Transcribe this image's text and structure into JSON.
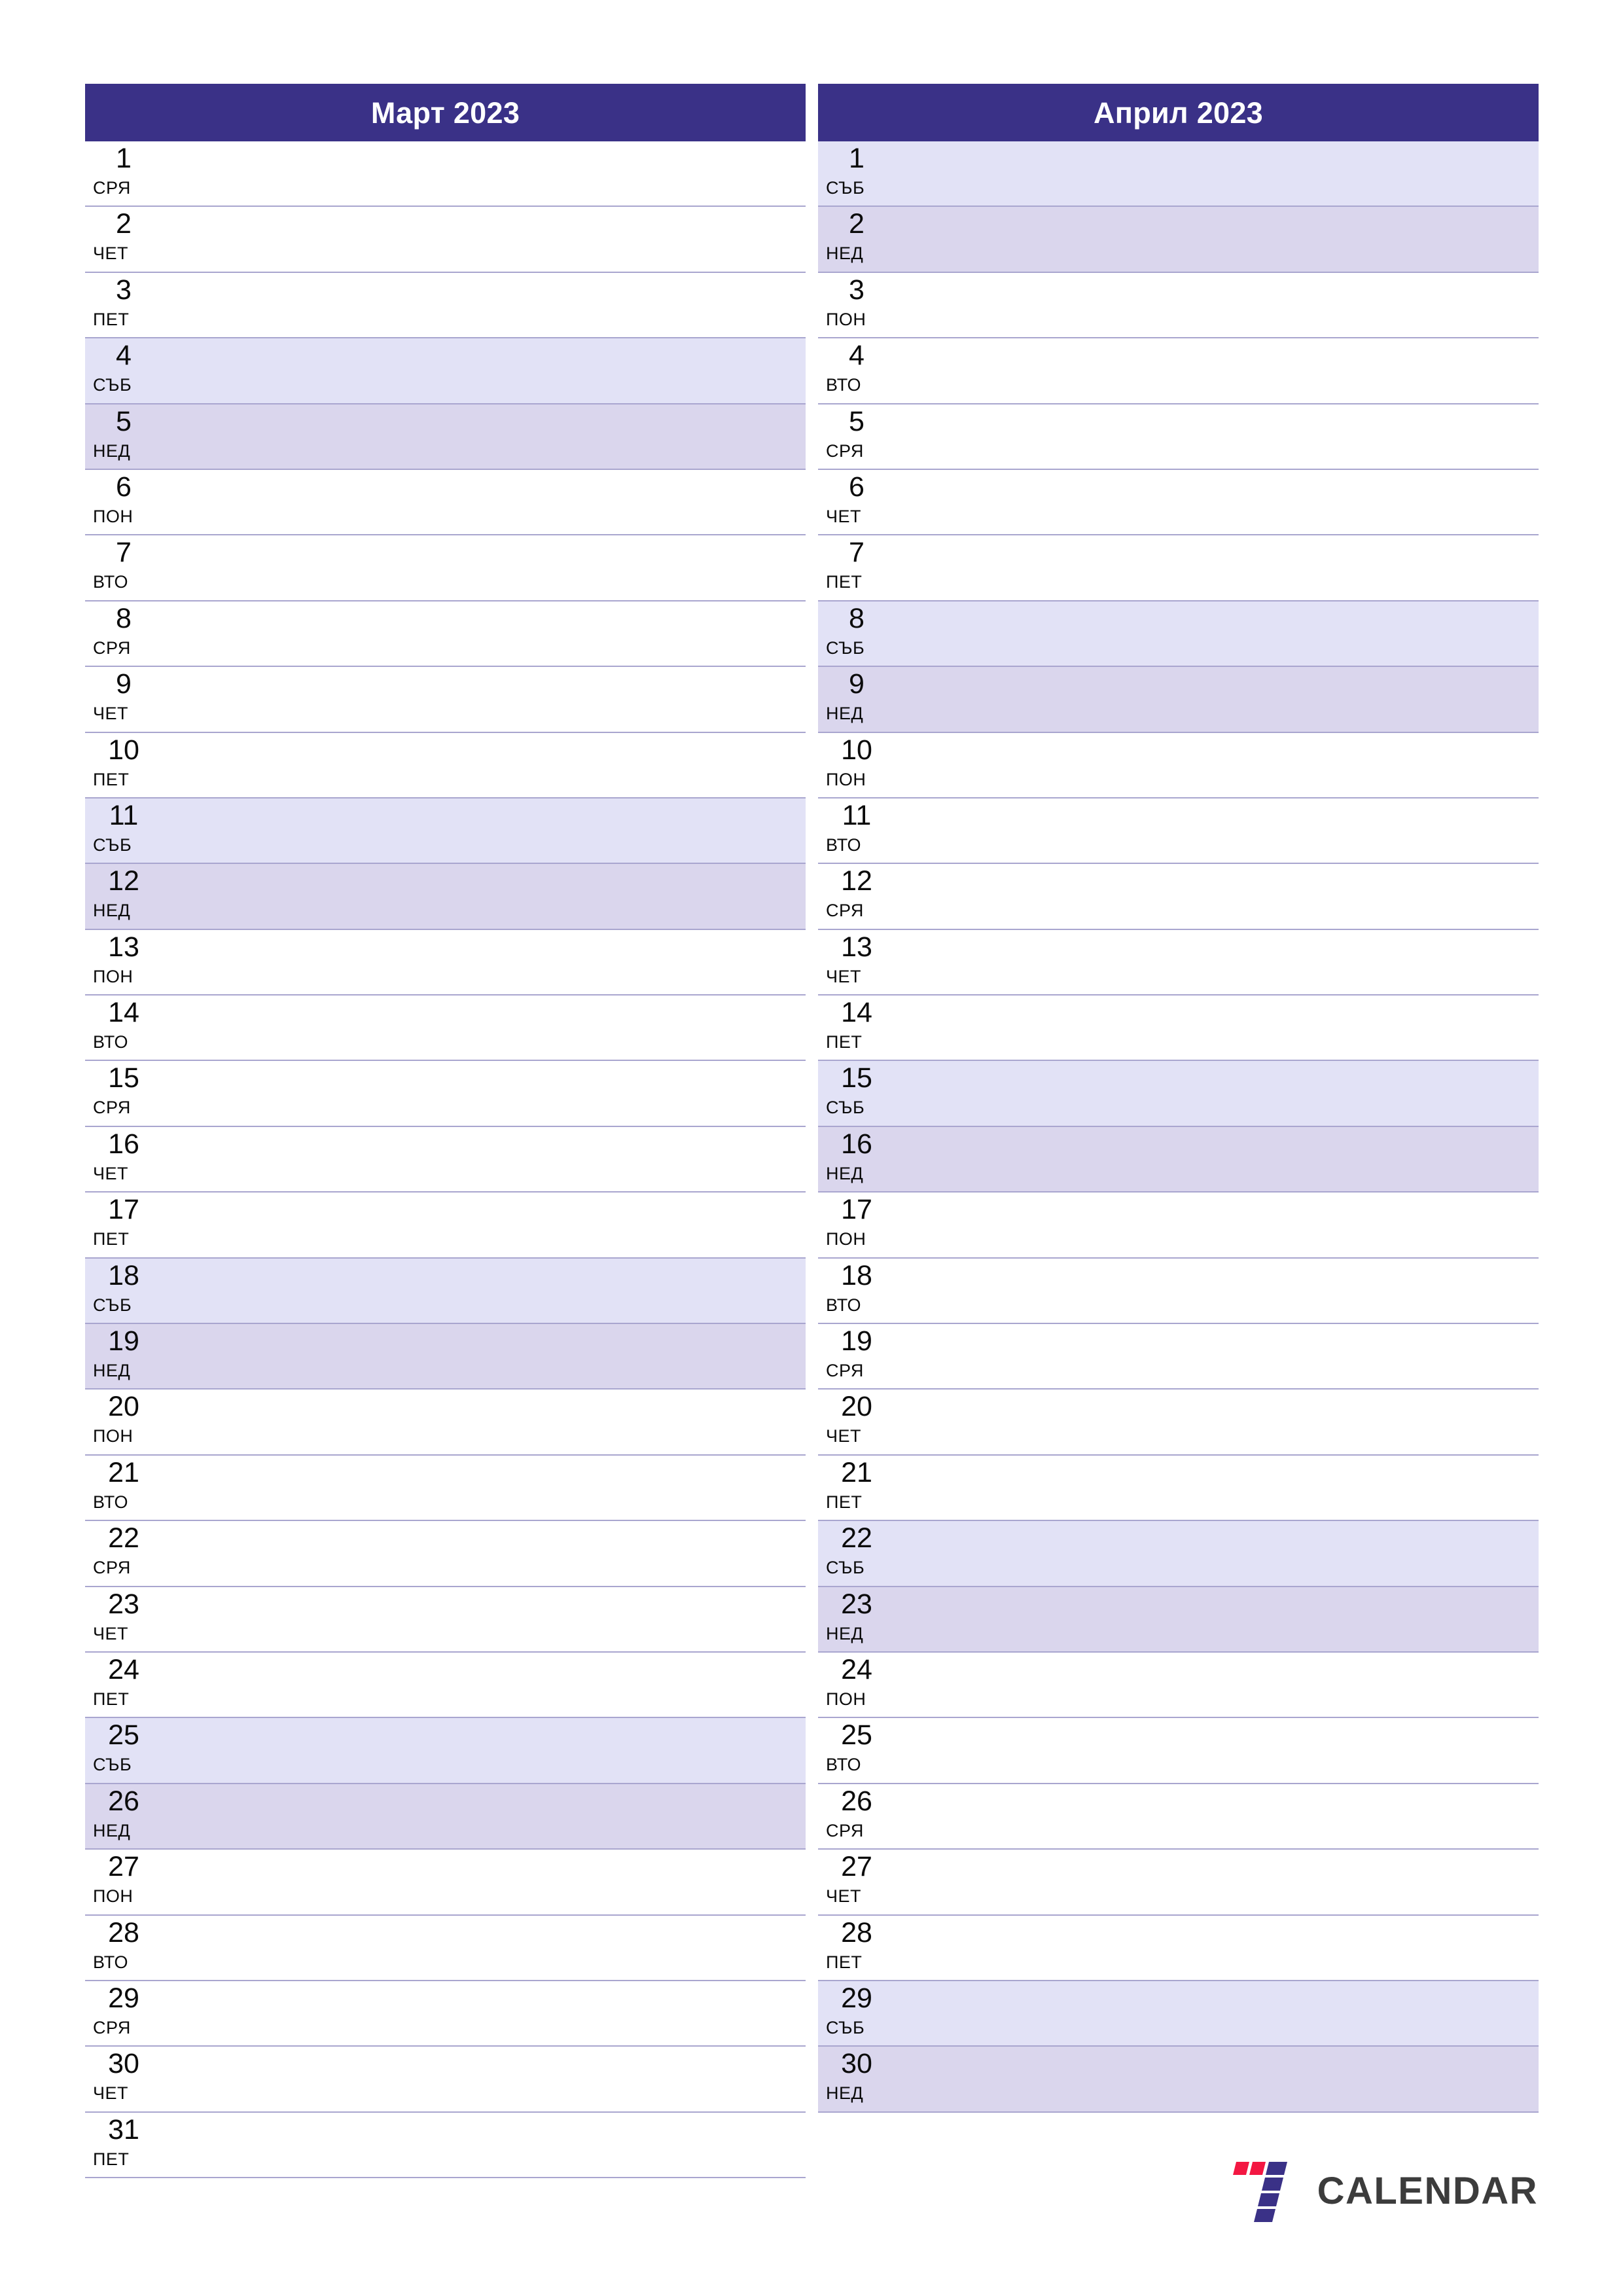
{
  "document": {
    "type": "two-month-planner",
    "year": "2023",
    "orientation": "portrait"
  },
  "theme": {
    "header_bg": "#3a3187",
    "header_text": "#ffffff",
    "saturday_bg": "#e2e2f6",
    "sunday_bg": "#dad6ed",
    "row_border": "#a9a6cf",
    "page_bg": "#ffffff",
    "text": "#0b0b0b"
  },
  "months": [
    {
      "title": "Март 2023",
      "days": [
        {
          "num": "1",
          "abbr": "СРЯ",
          "kind": "weekday"
        },
        {
          "num": "2",
          "abbr": "ЧЕТ",
          "kind": "weekday"
        },
        {
          "num": "3",
          "abbr": "ПЕТ",
          "kind": "weekday"
        },
        {
          "num": "4",
          "abbr": "СЪБ",
          "kind": "sat"
        },
        {
          "num": "5",
          "abbr": "НЕД",
          "kind": "sun"
        },
        {
          "num": "6",
          "abbr": "ПОН",
          "kind": "weekday"
        },
        {
          "num": "7",
          "abbr": "ВТО",
          "kind": "weekday"
        },
        {
          "num": "8",
          "abbr": "СРЯ",
          "kind": "weekday"
        },
        {
          "num": "9",
          "abbr": "ЧЕТ",
          "kind": "weekday"
        },
        {
          "num": "10",
          "abbr": "ПЕТ",
          "kind": "weekday"
        },
        {
          "num": "11",
          "abbr": "СЪБ",
          "kind": "sat"
        },
        {
          "num": "12",
          "abbr": "НЕД",
          "kind": "sun"
        },
        {
          "num": "13",
          "abbr": "ПОН",
          "kind": "weekday"
        },
        {
          "num": "14",
          "abbr": "ВТО",
          "kind": "weekday"
        },
        {
          "num": "15",
          "abbr": "СРЯ",
          "kind": "weekday"
        },
        {
          "num": "16",
          "abbr": "ЧЕТ",
          "kind": "weekday"
        },
        {
          "num": "17",
          "abbr": "ПЕТ",
          "kind": "weekday"
        },
        {
          "num": "18",
          "abbr": "СЪБ",
          "kind": "sat"
        },
        {
          "num": "19",
          "abbr": "НЕД",
          "kind": "sun"
        },
        {
          "num": "20",
          "abbr": "ПОН",
          "kind": "weekday"
        },
        {
          "num": "21",
          "abbr": "ВТО",
          "kind": "weekday"
        },
        {
          "num": "22",
          "abbr": "СРЯ",
          "kind": "weekday"
        },
        {
          "num": "23",
          "abbr": "ЧЕТ",
          "kind": "weekday"
        },
        {
          "num": "24",
          "abbr": "ПЕТ",
          "kind": "weekday"
        },
        {
          "num": "25",
          "abbr": "СЪБ",
          "kind": "sat"
        },
        {
          "num": "26",
          "abbr": "НЕД",
          "kind": "sun"
        },
        {
          "num": "27",
          "abbr": "ПОН",
          "kind": "weekday"
        },
        {
          "num": "28",
          "abbr": "ВТО",
          "kind": "weekday"
        },
        {
          "num": "29",
          "abbr": "СРЯ",
          "kind": "weekday"
        },
        {
          "num": "30",
          "abbr": "ЧЕТ",
          "kind": "weekday"
        },
        {
          "num": "31",
          "abbr": "ПЕТ",
          "kind": "weekday"
        }
      ]
    },
    {
      "title": "Април 2023",
      "days": [
        {
          "num": "1",
          "abbr": "СЪБ",
          "kind": "sat"
        },
        {
          "num": "2",
          "abbr": "НЕД",
          "kind": "sun"
        },
        {
          "num": "3",
          "abbr": "ПОН",
          "kind": "weekday"
        },
        {
          "num": "4",
          "abbr": "ВТО",
          "kind": "weekday"
        },
        {
          "num": "5",
          "abbr": "СРЯ",
          "kind": "weekday"
        },
        {
          "num": "6",
          "abbr": "ЧЕТ",
          "kind": "weekday"
        },
        {
          "num": "7",
          "abbr": "ПЕТ",
          "kind": "weekday"
        },
        {
          "num": "8",
          "abbr": "СЪБ",
          "kind": "sat"
        },
        {
          "num": "9",
          "abbr": "НЕД",
          "kind": "sun"
        },
        {
          "num": "10",
          "abbr": "ПОН",
          "kind": "weekday"
        },
        {
          "num": "11",
          "abbr": "ВТО",
          "kind": "weekday"
        },
        {
          "num": "12",
          "abbr": "СРЯ",
          "kind": "weekday"
        },
        {
          "num": "13",
          "abbr": "ЧЕТ",
          "kind": "weekday"
        },
        {
          "num": "14",
          "abbr": "ПЕТ",
          "kind": "weekday"
        },
        {
          "num": "15",
          "abbr": "СЪБ",
          "kind": "sat"
        },
        {
          "num": "16",
          "abbr": "НЕД",
          "kind": "sun"
        },
        {
          "num": "17",
          "abbr": "ПОН",
          "kind": "weekday"
        },
        {
          "num": "18",
          "abbr": "ВТО",
          "kind": "weekday"
        },
        {
          "num": "19",
          "abbr": "СРЯ",
          "kind": "weekday"
        },
        {
          "num": "20",
          "abbr": "ЧЕТ",
          "kind": "weekday"
        },
        {
          "num": "21",
          "abbr": "ПЕТ",
          "kind": "weekday"
        },
        {
          "num": "22",
          "abbr": "СЪБ",
          "kind": "sat"
        },
        {
          "num": "23",
          "abbr": "НЕД",
          "kind": "sun"
        },
        {
          "num": "24",
          "abbr": "ПОН",
          "kind": "weekday"
        },
        {
          "num": "25",
          "abbr": "ВТО",
          "kind": "weekday"
        },
        {
          "num": "26",
          "abbr": "СРЯ",
          "kind": "weekday"
        },
        {
          "num": "27",
          "abbr": "ЧЕТ",
          "kind": "weekday"
        },
        {
          "num": "28",
          "abbr": "ПЕТ",
          "kind": "weekday"
        },
        {
          "num": "29",
          "abbr": "СЪБ",
          "kind": "sat"
        },
        {
          "num": "30",
          "abbr": "НЕД",
          "kind": "sun"
        }
      ]
    }
  ],
  "logo": {
    "text": "CALENDAR",
    "mark_icon": "seven-logo-icon",
    "accent_red": "#f31742",
    "accent_blue": "#3a3187",
    "text_color": "#3c3c3c"
  }
}
